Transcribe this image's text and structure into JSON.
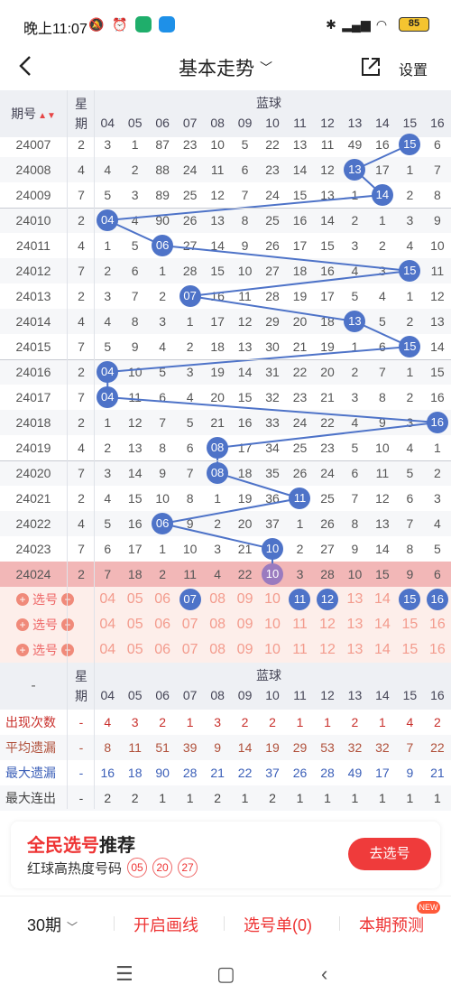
{
  "status": {
    "time": "晚上11:07",
    "battery": "85"
  },
  "header": {
    "title": "基本走势",
    "settings": "设置"
  },
  "table": {
    "col_period": "期号",
    "col_week": [
      "星",
      "期"
    ],
    "group_label": "蓝球",
    "numbers": [
      "04",
      "05",
      "06",
      "07",
      "08",
      "09",
      "10",
      "11",
      "12",
      "13",
      "14",
      "15",
      "16"
    ],
    "rows": [
      {
        "p": "24007",
        "w": "2",
        "c": [
          "3",
          "1",
          "87",
          "23",
          "10",
          "5",
          "22",
          "13",
          "11",
          "49",
          "16",
          "15",
          "6"
        ],
        "ball": 11
      },
      {
        "p": "24008",
        "w": "4",
        "c": [
          "4",
          "2",
          "88",
          "24",
          "11",
          "6",
          "23",
          "14",
          "12",
          "13",
          "17",
          "1",
          "7"
        ],
        "ball": 9
      },
      {
        "p": "24009",
        "w": "7",
        "c": [
          "5",
          "3",
          "89",
          "25",
          "12",
          "7",
          "24",
          "15",
          "13",
          "1",
          "14",
          "2",
          "8"
        ],
        "ball": 10
      },
      {
        "p": "24010",
        "w": "2",
        "c": [
          "04",
          "4",
          "90",
          "26",
          "13",
          "8",
          "25",
          "16",
          "14",
          "2",
          "1",
          "3",
          "9"
        ],
        "ball": 0
      },
      {
        "p": "24011",
        "w": "4",
        "c": [
          "1",
          "5",
          "06",
          "27",
          "14",
          "9",
          "26",
          "17",
          "15",
          "3",
          "2",
          "4",
          "10"
        ],
        "ball": 2
      },
      {
        "p": "24012",
        "w": "7",
        "c": [
          "2",
          "6",
          "1",
          "28",
          "15",
          "10",
          "27",
          "18",
          "16",
          "4",
          "3",
          "15",
          "11"
        ],
        "ball": 11
      },
      {
        "p": "24013",
        "w": "2",
        "c": [
          "3",
          "7",
          "2",
          "07",
          "16",
          "11",
          "28",
          "19",
          "17",
          "5",
          "4",
          "1",
          "12"
        ],
        "ball": 3
      },
      {
        "p": "24014",
        "w": "4",
        "c": [
          "4",
          "8",
          "3",
          "1",
          "17",
          "12",
          "29",
          "20",
          "18",
          "13",
          "5",
          "2",
          "13"
        ],
        "ball": 9
      },
      {
        "p": "24015",
        "w": "7",
        "c": [
          "5",
          "9",
          "4",
          "2",
          "18",
          "13",
          "30",
          "21",
          "19",
          "1",
          "6",
          "15",
          "14"
        ],
        "ball": 11
      },
      {
        "p": "24016",
        "w": "2",
        "c": [
          "04",
          "10",
          "5",
          "3",
          "19",
          "14",
          "31",
          "22",
          "20",
          "2",
          "7",
          "1",
          "15"
        ],
        "ball": 0
      },
      {
        "p": "24017",
        "w": "7",
        "c": [
          "04",
          "11",
          "6",
          "4",
          "20",
          "15",
          "32",
          "23",
          "21",
          "3",
          "8",
          "2",
          "16"
        ],
        "ball": 0
      },
      {
        "p": "24018",
        "w": "2",
        "c": [
          "1",
          "12",
          "7",
          "5",
          "21",
          "16",
          "33",
          "24",
          "22",
          "4",
          "9",
          "3",
          "16"
        ],
        "ball": 12
      },
      {
        "p": "24019",
        "w": "4",
        "c": [
          "2",
          "13",
          "8",
          "6",
          "08",
          "17",
          "34",
          "25",
          "23",
          "5",
          "10",
          "4",
          "1"
        ],
        "ball": 4
      },
      {
        "p": "24020",
        "w": "7",
        "c": [
          "3",
          "14",
          "9",
          "7",
          "08",
          "18",
          "35",
          "26",
          "24",
          "6",
          "11",
          "5",
          "2"
        ],
        "ball": 4
      },
      {
        "p": "24021",
        "w": "2",
        "c": [
          "4",
          "15",
          "10",
          "8",
          "1",
          "19",
          "36",
          "11",
          "25",
          "7",
          "12",
          "6",
          "3"
        ],
        "ball": 7
      },
      {
        "p": "24022",
        "w": "4",
        "c": [
          "5",
          "16",
          "06",
          "9",
          "2",
          "20",
          "37",
          "1",
          "26",
          "8",
          "13",
          "7",
          "4"
        ],
        "ball": 2
      },
      {
        "p": "24023",
        "w": "7",
        "c": [
          "6",
          "17",
          "1",
          "10",
          "3",
          "21",
          "10",
          "2",
          "27",
          "9",
          "14",
          "8",
          "5"
        ],
        "ball": 6
      },
      {
        "p": "24024",
        "w": "2",
        "c": [
          "7",
          "18",
          "2",
          "11",
          "4",
          "22",
          "10",
          "3",
          "28",
          "10",
          "15",
          "9",
          "6"
        ],
        "ball": 6
      }
    ],
    "pick_label": "选号",
    "pick_rows": [
      {
        "sel": [
          3,
          7,
          8,
          11,
          12
        ]
      },
      {
        "sel": []
      },
      {
        "sel": []
      }
    ],
    "stats": [
      {
        "name": "出现次数",
        "color": "#c9302c",
        "vals": [
          "4",
          "3",
          "2",
          "1",
          "3",
          "2",
          "2",
          "1",
          "1",
          "2",
          "1",
          "4",
          "2"
        ]
      },
      {
        "name": "平均遗漏",
        "color": "#b0503a",
        "vals": [
          "8",
          "11",
          "51",
          "39",
          "9",
          "14",
          "19",
          "29",
          "53",
          "32",
          "32",
          "7",
          "22"
        ]
      },
      {
        "name": "最大遗漏",
        "color": "#3b5fb8",
        "vals": [
          "16",
          "18",
          "90",
          "28",
          "21",
          "22",
          "37",
          "26",
          "28",
          "49",
          "17",
          "9",
          "21"
        ]
      },
      {
        "name": "最大连出",
        "color": "#444444",
        "vals": [
          "2",
          "2",
          "1",
          "1",
          "2",
          "1",
          "2",
          "1",
          "1",
          "1",
          "1",
          "1",
          "1"
        ]
      }
    ],
    "stat_dash": "-",
    "footer_dash": "-"
  },
  "recommend": {
    "title_red": "全民选号",
    "title_black": "推荐",
    "subtitle": "红球高热度号码",
    "balls": [
      "05",
      "20",
      "27"
    ],
    "button": "去选号"
  },
  "bottom": {
    "period": "30期",
    "draw_line": "开启画线",
    "pick_list": "选号单(0)",
    "predict": "本期预测",
    "new_badge": "NEW"
  },
  "colors": {
    "ball_blue": "#4e73c8",
    "accent_red": "#e33"
  }
}
